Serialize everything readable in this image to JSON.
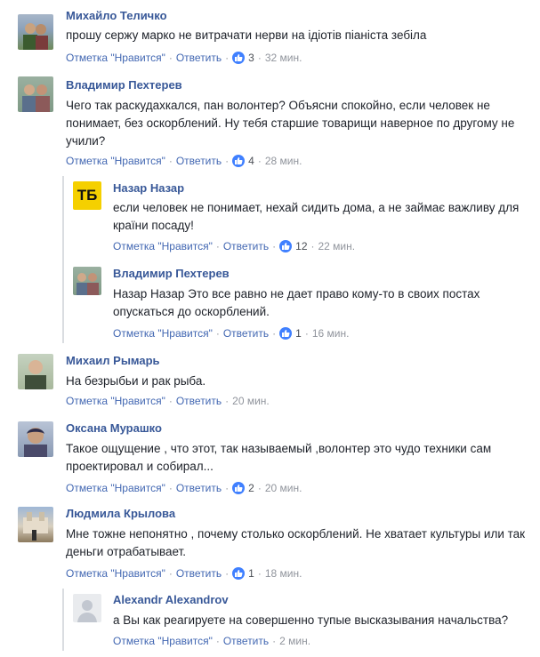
{
  "labels": {
    "like": "Отметка \"Нравится\"",
    "reply": "Ответить"
  },
  "colors": {
    "link": "#4267b2",
    "name": "#385898",
    "muted": "#90949c",
    "like_badge": "#4080ff"
  },
  "comments": [
    {
      "name": "Михайло Теличко",
      "text": "прошу сержу марко не витрачати нерви на ідіотів піаніста зебіла",
      "likes": "3",
      "time": "32 мин."
    },
    {
      "name": "Владимир Пехтерев",
      "text": "Чего так раскудахкался, пан волонтер? Объясни спокойно, если человек не понимает, без оскорблений. Ну тебя старшие товарищи наверное по другому не учили?",
      "likes": "4",
      "time": "28 мин."
    },
    {
      "name": "Назар Назар",
      "text": "если человек не понимает, нехай сидить дома, а не займає важливу для країни посаду!",
      "likes": "12",
      "time": "22 мин.",
      "avatar_text": "ТБ"
    },
    {
      "name": "Владимир Пехтерев",
      "text": "Назар Назар Это все равно не дает право кому-то в своих постах опускаться до оскорблений.",
      "likes": "1",
      "time": "16 мин."
    },
    {
      "name": "Михаил Рымарь",
      "text": "На безрыбьи и рак рыба.",
      "time": "20 мин."
    },
    {
      "name": "Оксана Мурашко",
      "text": "Такое ощущение , что этот, так называемый ,волонтер это чудо техники сам проектировал и собирал...",
      "likes": "2",
      "time": "20 мин."
    },
    {
      "name": "Людмила Крылова",
      "text": "Мне тожне непонятно , почему столько оскорблений. Не хватает культуры или так деньги отрабатывает.",
      "likes": "1",
      "time": "18 мин."
    },
    {
      "name": "Alexandr Alexandrov",
      "text": "а Вы как реагируете на совершенно тупые высказывания начальства?",
      "time": "2 мин."
    }
  ]
}
